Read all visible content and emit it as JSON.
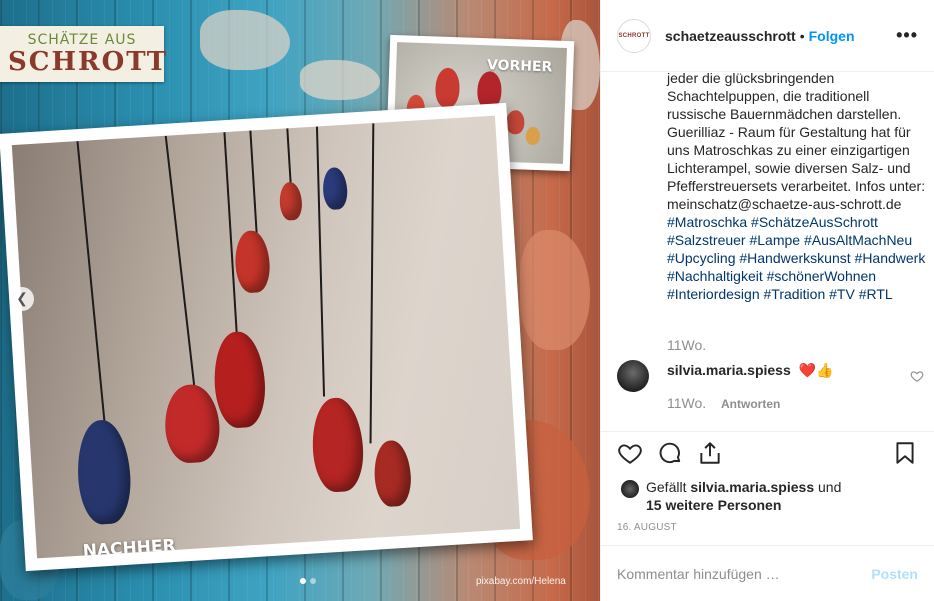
{
  "photo": {
    "logo_line1": "SCHÄTZE AUS",
    "logo_line2": "SCHROTT",
    "before_label": "VORHER",
    "after_label": "NACHHER",
    "credit": "pixabay.com/Helena",
    "prev_icon": "chevron-left-icon"
  },
  "header": {
    "username": "schaetzeausschrott",
    "separator": "•",
    "follow_label": "Folgen",
    "more_icon": "more-horizontal-icon",
    "avatar_text": "SCHROTT"
  },
  "caption": {
    "text": "jeder die glücksbringenden Schachtelpuppen, die traditionell russische Bauernmädchen darstellen. Guerilliaz - Raum für Gestaltung hat für uns Matroschkas zu einer einzigartigen Lichterampel, sowie diversen Salz- und Pfefferstreuersets verarbeitet. Infos unter: meinschatz@schaetze-aus-schrott.de",
    "hashtags": "#Matroschka #SchätzeAusSchrott #Salzstreuer #Lampe #AusAltMachNeu #Upcycling #Handwerkskunst #Handwerk #Nachhaltigkeit #schönerWohnen #Interiordesign #Tradition #TV #RTL",
    "time": "11Wo."
  },
  "comment": {
    "username": "silvia.maria.spiess",
    "text": "❤️👍",
    "time": "11Wo.",
    "reply_label": "Antworten"
  },
  "likes": {
    "prefix": "Gefällt",
    "user": "silvia.maria.spiess",
    "joiner": "und",
    "others": "15 weitere Personen"
  },
  "date": "16. AUGUST",
  "composer": {
    "placeholder": "Kommentar hinzufügen …",
    "post_label": "Posten"
  },
  "colors": {
    "link_blue": "#0095f6",
    "hashtag_blue": "#00376b",
    "muted": "#8e8e8e",
    "post_disabled": "#b2dffc"
  }
}
